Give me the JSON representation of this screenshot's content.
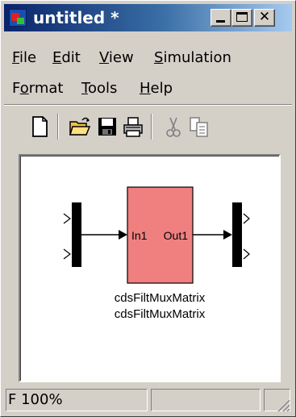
{
  "window": {
    "title": "untitled *"
  },
  "menubar": {
    "items": [
      {
        "prefix": "",
        "underlined": "F",
        "rest": "ile"
      },
      {
        "prefix": "",
        "underlined": "E",
        "rest": "dit"
      },
      {
        "prefix": "",
        "underlined": "V",
        "rest": "iew"
      },
      {
        "prefix": "",
        "underlined": "S",
        "rest": "imulation"
      },
      {
        "prefix": "F",
        "underlined": "o",
        "rest": "rmat"
      },
      {
        "prefix": "",
        "underlined": "T",
        "rest": "ools"
      },
      {
        "prefix": "",
        "underlined": "H",
        "rest": "elp"
      }
    ]
  },
  "toolbar": {
    "icons": [
      "new-icon",
      "open-icon",
      "save-icon",
      "print-icon",
      "cut-icon",
      "copy-icon"
    ]
  },
  "diagram": {
    "block": {
      "in_port_label": "In1",
      "out_port_label": "Out1",
      "name_line1": "cdsFiltMuxMatrix",
      "name_line2": "cdsFiltMuxMatrix",
      "fill_color": "#f08080"
    }
  },
  "status": {
    "left": "F",
    "zoom": "100%"
  }
}
